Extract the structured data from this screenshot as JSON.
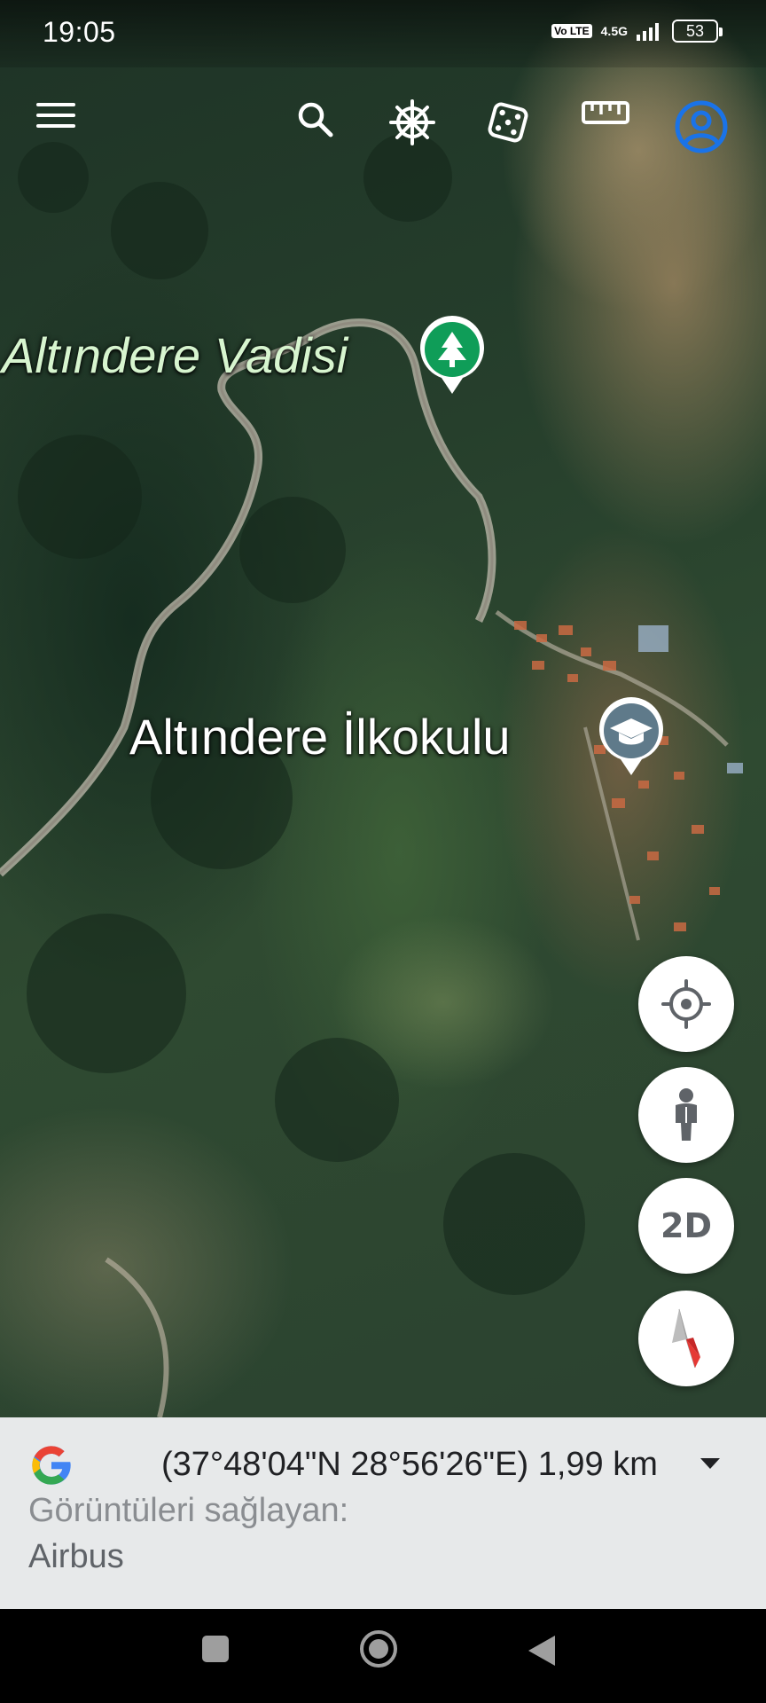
{
  "status_bar": {
    "time": "19:05",
    "volte": "Vo LTE",
    "network": "4.5G",
    "battery": "53"
  },
  "toolbar": {
    "items": [
      {
        "name": "menu-icon"
      },
      {
        "name": "search-icon"
      },
      {
        "name": "voyager-wheel-icon"
      },
      {
        "name": "dice-icon"
      },
      {
        "name": "ruler-icon"
      },
      {
        "name": "account-icon"
      }
    ]
  },
  "map": {
    "labels": {
      "valley": "Altındere Vadisi",
      "school": "Altındere İlkokulu"
    },
    "pins": {
      "valley_icon": "tree-icon",
      "school_icon": "graduation-cap-icon"
    }
  },
  "fabs": {
    "locate_icon": "crosshair-icon",
    "streetview_icon": "pegman-icon",
    "view_mode": "2D",
    "compass_icon": "compass-icon"
  },
  "info_panel": {
    "coordinates": "(37°48'04\"N 28°56'26\"E) 1,99 km",
    "credit_label": "Görüntüleri sağlayan:",
    "credit_value": "Airbus"
  },
  "colors": {
    "account_blue": "#1a73e8",
    "valley_pin": "#0f9d58",
    "school_pin": "#5f7a8a",
    "compass_red": "#e53935"
  }
}
